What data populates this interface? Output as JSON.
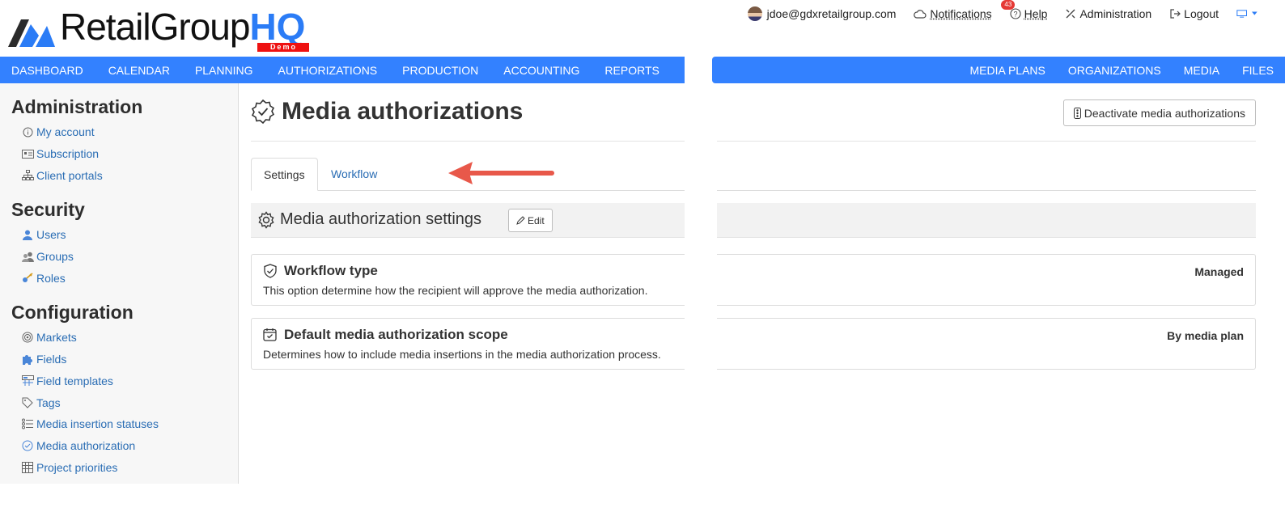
{
  "header": {
    "logo": {
      "text": "RetailGroup",
      "hq": "HQ",
      "demo": "Demo"
    },
    "user_email": "jdoe@gdxretailgroup.com",
    "notifications_label": "Notifications",
    "notifications_count": "43",
    "help_label": "Help",
    "administration_label": "Administration",
    "logout_label": "Logout"
  },
  "nav": {
    "left": [
      "DASHBOARD",
      "CALENDAR",
      "PLANNING",
      "AUTHORIZATIONS",
      "PRODUCTION",
      "ACCOUNTING",
      "REPORTS"
    ],
    "right": [
      "MEDIA PLANS",
      "ORGANIZATIONS",
      "MEDIA",
      "FILES"
    ]
  },
  "sidebar": {
    "sections": [
      {
        "heading": "Administration",
        "items": [
          {
            "label": "My account",
            "icon": "info-icon"
          },
          {
            "label": "Subscription",
            "icon": "id-card-icon"
          },
          {
            "label": "Client portals",
            "icon": "sitemap-icon"
          }
        ]
      },
      {
        "heading": "Security",
        "items": [
          {
            "label": "Users",
            "icon": "user-icon"
          },
          {
            "label": "Groups",
            "icon": "users-icon"
          },
          {
            "label": "Roles",
            "icon": "roles-icon"
          }
        ]
      },
      {
        "heading": "Configuration",
        "items": [
          {
            "label": "Markets",
            "icon": "target-icon"
          },
          {
            "label": "Fields",
            "icon": "puzzle-icon"
          },
          {
            "label": "Field templates",
            "icon": "template-icon"
          },
          {
            "label": "Tags",
            "icon": "tag-icon"
          },
          {
            "label": "Media insertion statuses",
            "icon": "status-list-icon"
          },
          {
            "label": "Media authorization",
            "icon": "check-badge-icon"
          },
          {
            "label": "Project priorities",
            "icon": "grid-icon"
          }
        ]
      }
    ]
  },
  "page": {
    "title": "Media authorizations",
    "deactivate_label": "Deactivate media authorizations",
    "tabs": [
      {
        "label": "Settings",
        "active": true
      },
      {
        "label": "Workflow",
        "active": false
      }
    ],
    "settings_title": "Media authorization settings",
    "edit_label": "Edit",
    "cards": [
      {
        "title": "Workflow type",
        "description": "This option determine how the recipient will approve the media authorization.",
        "value": "Managed",
        "icon": "shield-check-icon"
      },
      {
        "title": "Default media authorization scope",
        "description": "Determines how to include media insertions in the media authorization process.",
        "value": "By media plan",
        "icon": "calendar-check-icon"
      }
    ]
  },
  "colors": {
    "nav": "#3381ff",
    "link": "#2a6db4",
    "arrow": "#e8584a",
    "badge": "#e53935"
  }
}
